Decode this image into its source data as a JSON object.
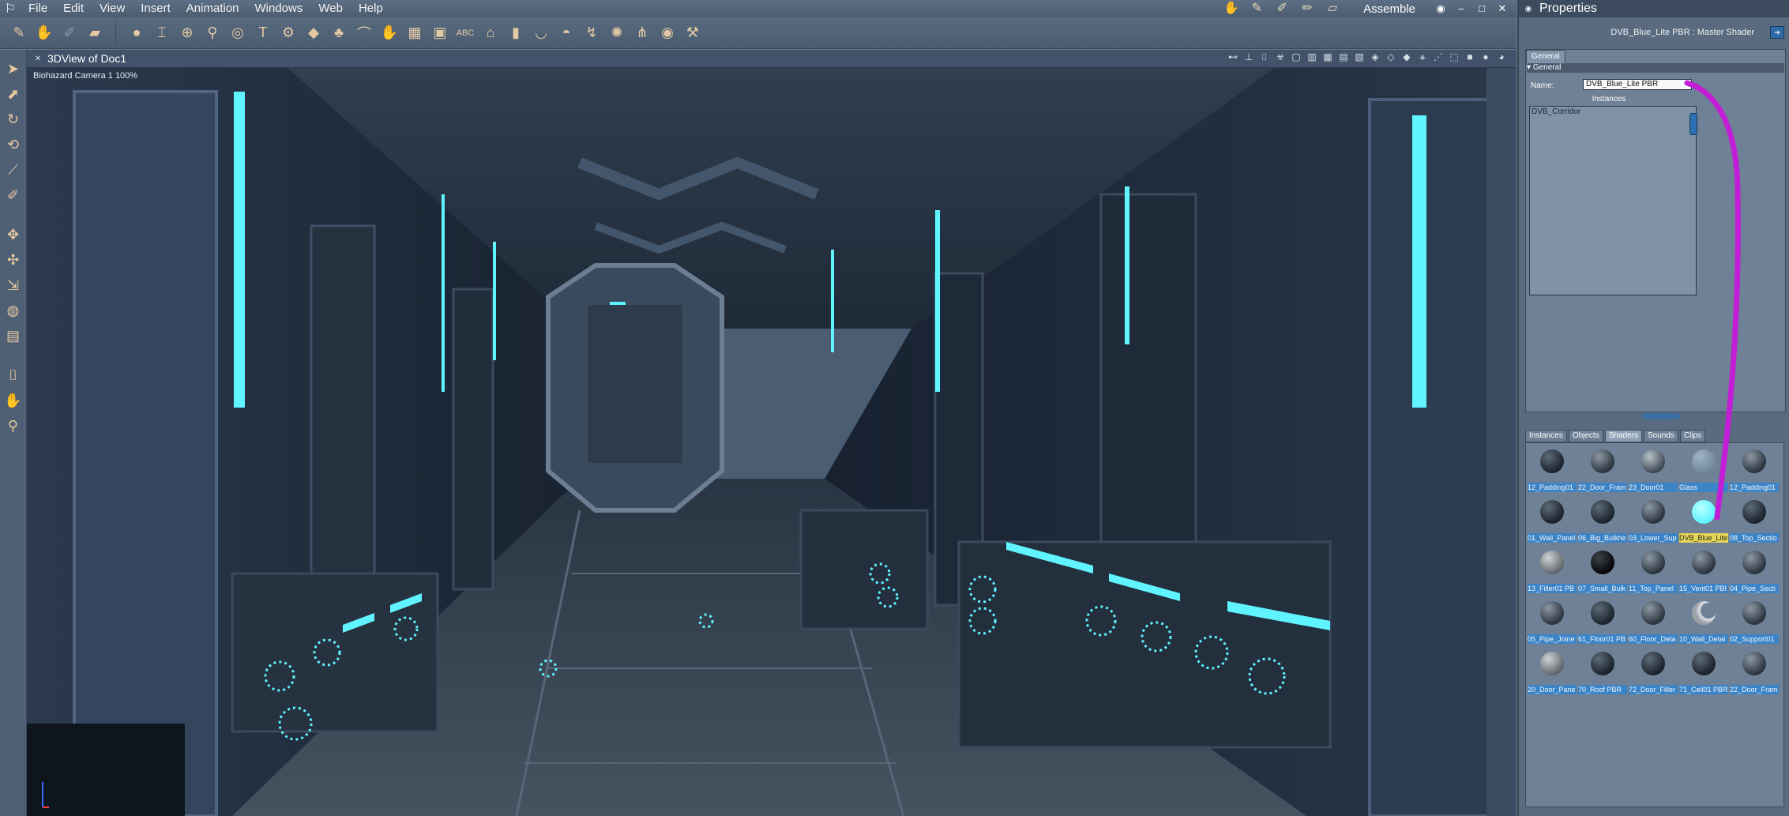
{
  "menubar": {
    "items": [
      "File",
      "Edit",
      "View",
      "Insert",
      "Animation",
      "Windows",
      "Web",
      "Help"
    ],
    "room": "Assemble"
  },
  "viewport": {
    "title": "3DView of Doc1",
    "camera_label": "Biohazard Camera 1 100%"
  },
  "properties": {
    "title": "Properties",
    "shader_path": "DVB_Blue_Lite PBR : Master Shader",
    "tab": "General",
    "section": "General",
    "name_label": "Name:",
    "name_value": "DVB_Blue_Lite PBR",
    "instances_label": "Instances",
    "instances": [
      "DVB_Corridor"
    ]
  },
  "library": {
    "tabs": [
      "Instances",
      "Objects",
      "Shaders",
      "Sounds",
      "Clips"
    ],
    "active_tab": "Shaders",
    "shaders": [
      {
        "label": "12_Padding01",
        "style": "dark"
      },
      {
        "label": "22_Door_Fram",
        "style": "stripe"
      },
      {
        "label": "23_Door01",
        "style": "metal"
      },
      {
        "label": "Glass",
        "style": "glass"
      },
      {
        "label": "12_Padding01",
        "style": "stripe"
      },
      {
        "label": "01_Wall_Panel",
        "style": "dark"
      },
      {
        "label": "06_Big_Bulkhe",
        "style": "dark"
      },
      {
        "label": "03_Lower_Sup",
        "style": "stripe"
      },
      {
        "label": "DVB_Blue_Lite",
        "style": "cyan",
        "selected": true
      },
      {
        "label": "08_Top_Sectio",
        "style": "dark"
      },
      {
        "label": "13_Filler01 PB",
        "style": "grey"
      },
      {
        "label": "07_Small_Bulk",
        "style": "black"
      },
      {
        "label": "11_Top_Panel",
        "style": "stripe"
      },
      {
        "label": "15_Vent01 PBI",
        "style": "stripe"
      },
      {
        "label": "04_Pipe_Secti",
        "style": "stripe"
      },
      {
        "label": "05_Pipe_Joine",
        "style": "stripe"
      },
      {
        "label": "61_Floor01 PB",
        "style": "dark"
      },
      {
        "label": "60_Floor_Deta",
        "style": "stripe"
      },
      {
        "label": "10_Wall_Detai",
        "style": "moon"
      },
      {
        "label": "02_Support01",
        "style": "stripe"
      },
      {
        "label": "20_Door_Pane",
        "style": "grey"
      },
      {
        "label": "70_Roof PBR",
        "style": "dark"
      },
      {
        "label": "72_Door_Filler",
        "style": "dark"
      },
      {
        "label": "71_Ceil01 PBR",
        "style": "dark"
      },
      {
        "label": "22_Door_Fram",
        "style": "stripe"
      }
    ]
  },
  "colors": {
    "accent_cyan": "#5ff4ff",
    "annotation_magenta": "#c21ed6",
    "selected_label": "#e4d45a"
  }
}
